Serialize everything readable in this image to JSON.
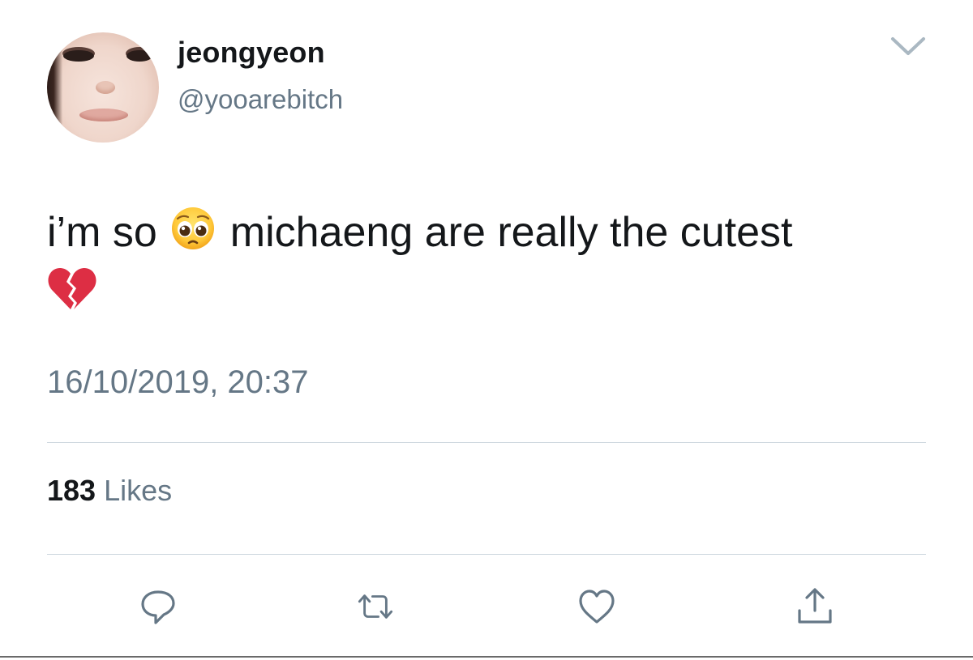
{
  "tweet": {
    "display_name": "jeongyeon",
    "handle": "@yooarebitch",
    "text_part1": "i’m so",
    "text_part2": "michaeng are really the cutest",
    "emoji_1": "pleading-face-emoji",
    "emoji_2": "broken-heart-emoji",
    "timestamp": "16/10/2019, 20:37",
    "likes_count": "183",
    "likes_label": "Likes"
  },
  "actions": {
    "reply_icon": "reply-icon",
    "retweet_icon": "retweet-icon",
    "like_icon": "heart-icon",
    "share_icon": "share-icon"
  },
  "colors": {
    "primary_text": "#14171a",
    "secondary_text": "#657786",
    "divider": "#ccd6dd",
    "icon": "#657786"
  }
}
